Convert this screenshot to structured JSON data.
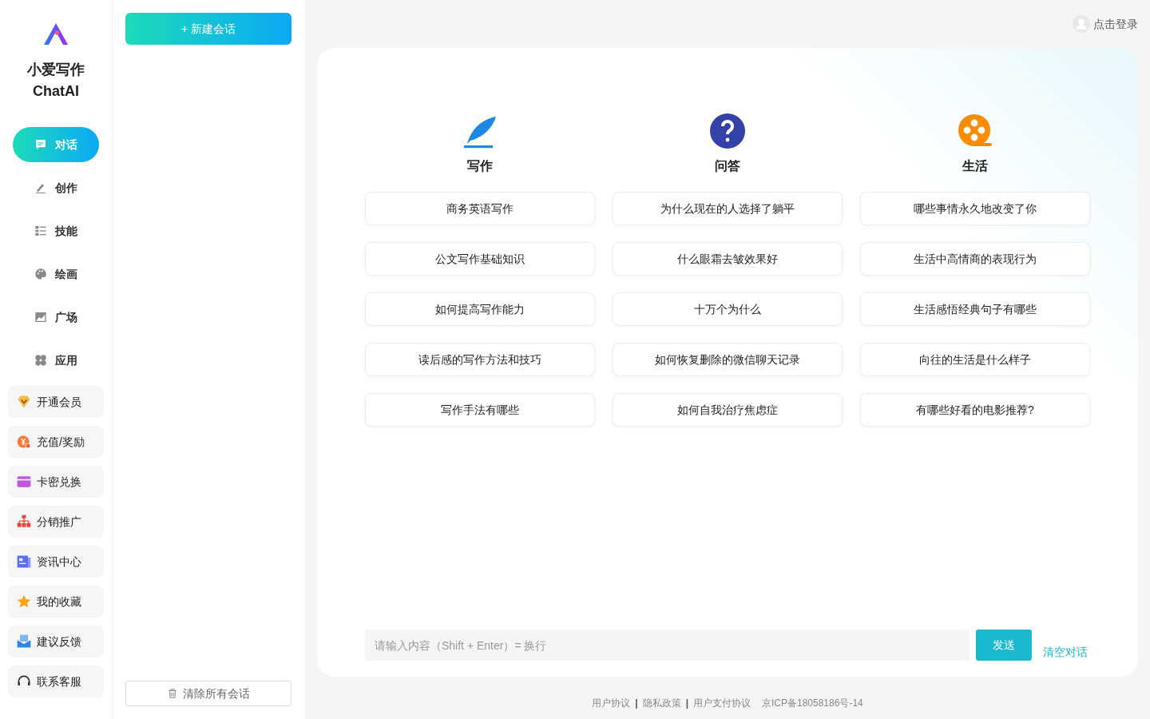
{
  "brand": {
    "name": "小爱写作",
    "subtitle": "ChatAI"
  },
  "nav": [
    {
      "label": "对话",
      "selected": true
    },
    {
      "label": "创作",
      "selected": false
    },
    {
      "label": "技能",
      "selected": false
    },
    {
      "label": "绘画",
      "selected": false
    },
    {
      "label": "广场",
      "selected": false
    },
    {
      "label": "应用",
      "selected": false
    }
  ],
  "menu": [
    "开通会员",
    "充值/奖励",
    "卡密兑换",
    "分销推广",
    "资讯中心",
    "我的收藏",
    "建议反馈",
    "联系客服"
  ],
  "sessions": {
    "new_button": "+ 新建会话",
    "clear_button": "清除所有会话"
  },
  "login": "点击登录",
  "categories": [
    {
      "title": "写作",
      "prompts": [
        "商务英语写作",
        "公文写作基础知识",
        "如何提高写作能力",
        "读后感的写作方法和技巧",
        "写作手法有哪些"
      ]
    },
    {
      "title": "问答",
      "prompts": [
        "为什么现在的人选择了躺平",
        "什么眼霜去皱效果好",
        "十万个为什么",
        "如何恢复删除的微信聊天记录",
        "如何自我治疗焦虑症"
      ]
    },
    {
      "title": "生活",
      "prompts": [
        "哪些事情永久地改变了你",
        "生活中高情商的表现行为",
        "生活感悟经典句子有哪些",
        "向往的生活是什么样子",
        "有哪些好看的电影推荐?"
      ]
    }
  ],
  "composer": {
    "placeholder": "请输入内容（Shift + Enter）= 换行",
    "send": "发送",
    "clear": "清空对话"
  },
  "footer": {
    "items": [
      {
        "kind": "link",
        "text": "用户协议"
      },
      {
        "kind": "sep",
        "text": "|"
      },
      {
        "kind": "link",
        "text": "隐私政策"
      },
      {
        "kind": "sep",
        "text": "|"
      },
      {
        "kind": "link",
        "text": "用户支付协议"
      }
    ],
    "icp": "京ICP备18058186号-14"
  }
}
